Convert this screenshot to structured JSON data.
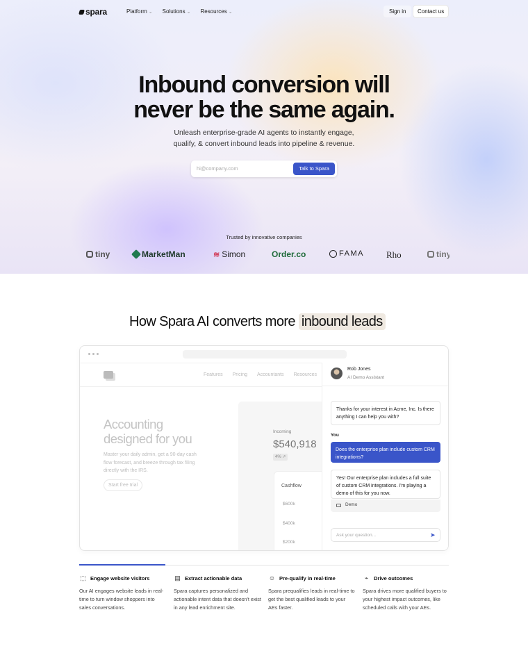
{
  "nav": {
    "logo": "spara",
    "links": [
      {
        "label": "Platform"
      },
      {
        "label": "Solutions"
      },
      {
        "label": "Resources"
      }
    ],
    "signin": "Sign in",
    "contact": "Contact us"
  },
  "hero": {
    "headline_1": "Inbound conversion will",
    "headline_2": "never be the same again.",
    "sub_1": "Unleash enterprise-grade AI agents to instantly engage,",
    "sub_2": "qualify, & convert inbound leads into pipeline & revenue.",
    "email_placeholder": "hi@company.com",
    "cta": "Talk to Spara",
    "trusted": "Trusted by innovative companies",
    "brands": [
      "tiny",
      "MarketMan",
      "Simon",
      "Order.co",
      "FAMA",
      "Rho",
      "tiny"
    ]
  },
  "section2": {
    "title_pre": "How Spara AI converts more",
    "title_highlight": "inbound leads"
  },
  "demo": {
    "site_nav": [
      "Features",
      "Pricing",
      "Accountants",
      "Resources"
    ],
    "headline_1": "Accounting",
    "headline_2": "designed for you",
    "para_1": "Master your daily admin, get a 90-day cash",
    "para_2": "flow forecast, and breeze through tax filing",
    "para_3": "directly with the IRS.",
    "trial": "Start free trial",
    "incoming_label": "Incoming",
    "incoming_value": "$540,918",
    "incoming_pct": "4% ↗",
    "cashflow_label": "Cashflow",
    "cashflow_ticks": [
      "$600k",
      "$400k",
      "$200k"
    ],
    "chat": {
      "agent_name": "Rob Jones",
      "agent_role": "AI Demo Assistant",
      "msg_1": "Thanks for your interest in Acme, Inc. Is there anything I can help you with?",
      "you_label": "You",
      "msg_2": "Does the enterprise plan include custom CRM integrations?",
      "msg_3": "Yes! Our enterprise plan includes a full suite of custom CRM integrations. I'm playing a demo of this for you now.",
      "demo_label": "Demo",
      "ask_placeholder": "Ask your question..."
    }
  },
  "features": [
    {
      "title": "Engage website visitors",
      "icon": "cursor-icon",
      "desc": "Our AI engages website leads in real-time to turn window shoppers into sales conversations."
    },
    {
      "title": "Extract actionable data",
      "icon": "data-icon",
      "desc": "Spara captures personalized and actionable intent data that doesn't exist in any lead enrichment site."
    },
    {
      "title": "Pre-qualify in real-time",
      "icon": "person-icon",
      "desc": "Spara prequalifies leads in real-time to get the best qualified leads to your AEs faster."
    },
    {
      "title": "Drive outcomes",
      "icon": "chart-icon",
      "desc": "Spara drives more qualified buyers to your highest impact outcomes, like scheduled calls with your AEs."
    }
  ],
  "colors": {
    "accent": "#3a55c9",
    "highlight": "#efe9e1"
  }
}
